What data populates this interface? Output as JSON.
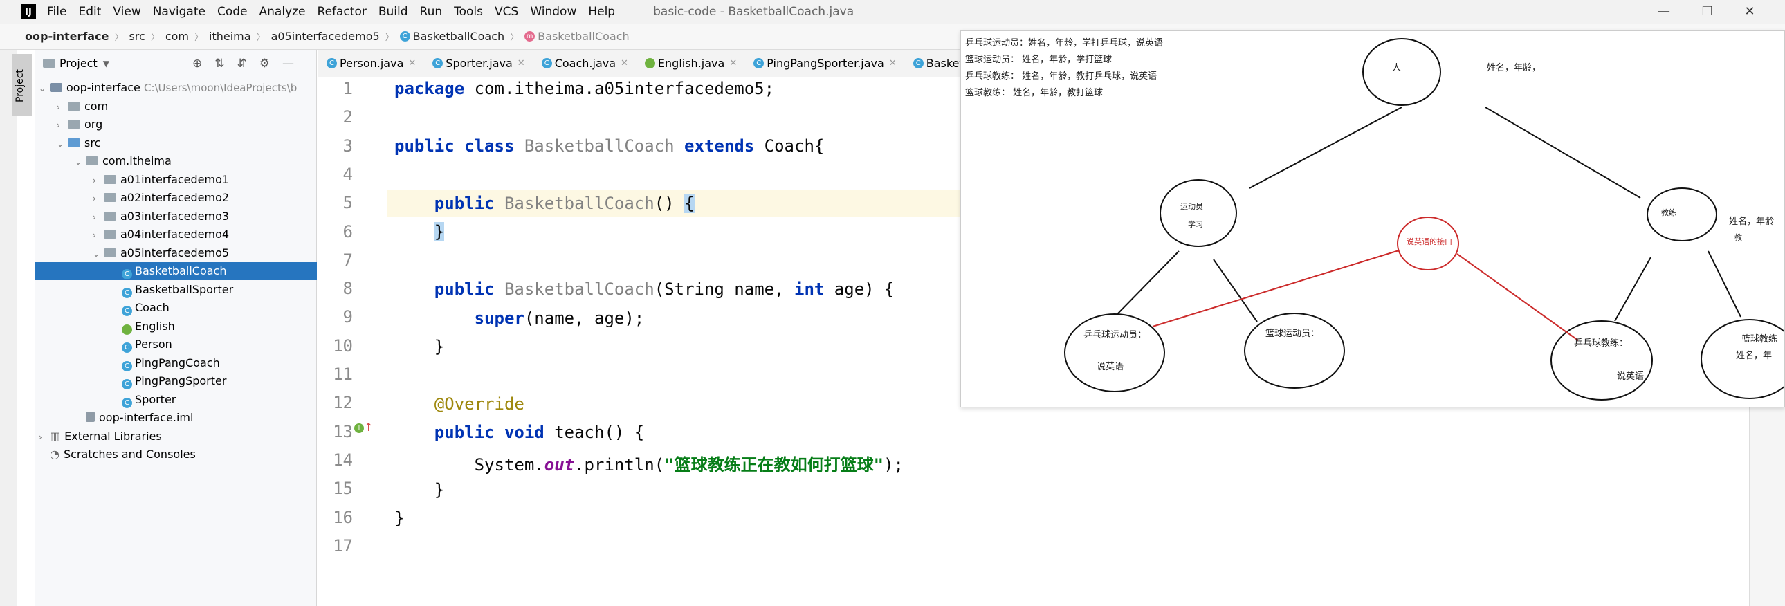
{
  "window": {
    "logo": "IJ",
    "menu": [
      "File",
      "Edit",
      "View",
      "Navigate",
      "Code",
      "Analyze",
      "Refactor",
      "Build",
      "Run",
      "Tools",
      "VCS",
      "Window",
      "Help"
    ],
    "title": "basic-code - BasketballCoach.java",
    "controls": [
      "—",
      "❐",
      "✕"
    ]
  },
  "breadcrumb": [
    "oop-interface",
    "src",
    "com",
    "itheima",
    "a05interfacedemo5",
    "BasketballCoach",
    "BasketballCoach"
  ],
  "project_panel": {
    "title": "Project",
    "tab_label": "Project",
    "tree": [
      {
        "label": "oop-interface",
        "hint": "C:\\Users\\moon\\IdeaProjects\\b",
        "indent": 0,
        "arrow": "⌄",
        "icon": "module"
      },
      {
        "label": "com",
        "indent": 1,
        "arrow": "›",
        "icon": "folder"
      },
      {
        "label": "org",
        "indent": 1,
        "arrow": "›",
        "icon": "folder"
      },
      {
        "label": "src",
        "indent": 1,
        "arrow": "⌄",
        "icon": "src"
      },
      {
        "label": "com.itheima",
        "indent": 2,
        "arrow": "⌄",
        "icon": "package"
      },
      {
        "label": "a01interfacedemo1",
        "indent": 3,
        "arrow": "›",
        "icon": "package"
      },
      {
        "label": "a02interfacedemo2",
        "indent": 3,
        "arrow": "›",
        "icon": "package"
      },
      {
        "label": "a03interfacedemo3",
        "indent": 3,
        "arrow": "›",
        "icon": "package"
      },
      {
        "label": "a04interfacedemo4",
        "indent": 3,
        "arrow": "›",
        "icon": "package"
      },
      {
        "label": "a05interfacedemo5",
        "indent": 3,
        "arrow": "⌄",
        "icon": "package"
      },
      {
        "label": "BasketballCoach",
        "indent": 4,
        "arrow": "",
        "icon": "class",
        "selected": true
      },
      {
        "label": "BasketballSporter",
        "indent": 4,
        "arrow": "",
        "icon": "class"
      },
      {
        "label": "Coach",
        "indent": 4,
        "arrow": "",
        "icon": "class"
      },
      {
        "label": "English",
        "indent": 4,
        "arrow": "",
        "icon": "interface"
      },
      {
        "label": "Person",
        "indent": 4,
        "arrow": "",
        "icon": "class"
      },
      {
        "label": "PingPangCoach",
        "indent": 4,
        "arrow": "",
        "icon": "class"
      },
      {
        "label": "PingPangSporter",
        "indent": 4,
        "arrow": "",
        "icon": "class"
      },
      {
        "label": "Sporter",
        "indent": 4,
        "arrow": "",
        "icon": "class"
      },
      {
        "label": "oop-interface.iml",
        "indent": 2,
        "arrow": "",
        "icon": "file"
      },
      {
        "label": "External Libraries",
        "indent": 0,
        "arrow": "›",
        "icon": "library"
      },
      {
        "label": "Scratches and Consoles",
        "indent": 0,
        "arrow": "",
        "icon": "scratch"
      }
    ]
  },
  "editor_tabs": [
    {
      "label": "Person.java",
      "icon": "class"
    },
    {
      "label": "Sporter.java",
      "icon": "class"
    },
    {
      "label": "Coach.java",
      "icon": "class"
    },
    {
      "label": "English.java",
      "icon": "interface"
    },
    {
      "label": "PingPangSporter.java",
      "icon": "class"
    },
    {
      "label": "Basketb",
      "icon": "class"
    }
  ],
  "code": {
    "line_numbers": [
      "1",
      "2",
      "3",
      "4",
      "5",
      "6",
      "7",
      "8",
      "9",
      "10",
      "11",
      "12",
      "13",
      "14",
      "15",
      "16",
      "17"
    ]
  },
  "diagram": {
    "descriptions": [
      "乒乓球运动员：姓名，年龄，学打乒乓球，说英语",
      "篮球运动员：   姓名，年龄，学打篮球",
      "乒乓球教练：   姓名，年龄，教打乒乓球，说英语",
      "篮球教练：     姓名，年龄，教打篮球"
    ],
    "person": "人",
    "person_attrs": "姓名，年龄，",
    "sporter_1": "运动员",
    "sporter_2": "学习",
    "coach": "教练",
    "coach_attrs": "姓名，年龄",
    "coach_attrs_2": "教",
    "interface": "说英语的接口",
    "pp_sporter": "乒乓球运动员：",
    "pp_sporter_2": "说英语",
    "bb_sporter": "篮球运动员：",
    "pp_coach": "乒乓球教练：",
    "pp_coach_2": "说英语",
    "bb_coach": "篮球教练",
    "bb_coach_2": "姓名，年"
  },
  "colors": {
    "keyword": "#0033b3",
    "string": "#067d17",
    "annotation": "#9e880d",
    "selection": "#2675bf",
    "interface_red": "#d42b2b"
  }
}
